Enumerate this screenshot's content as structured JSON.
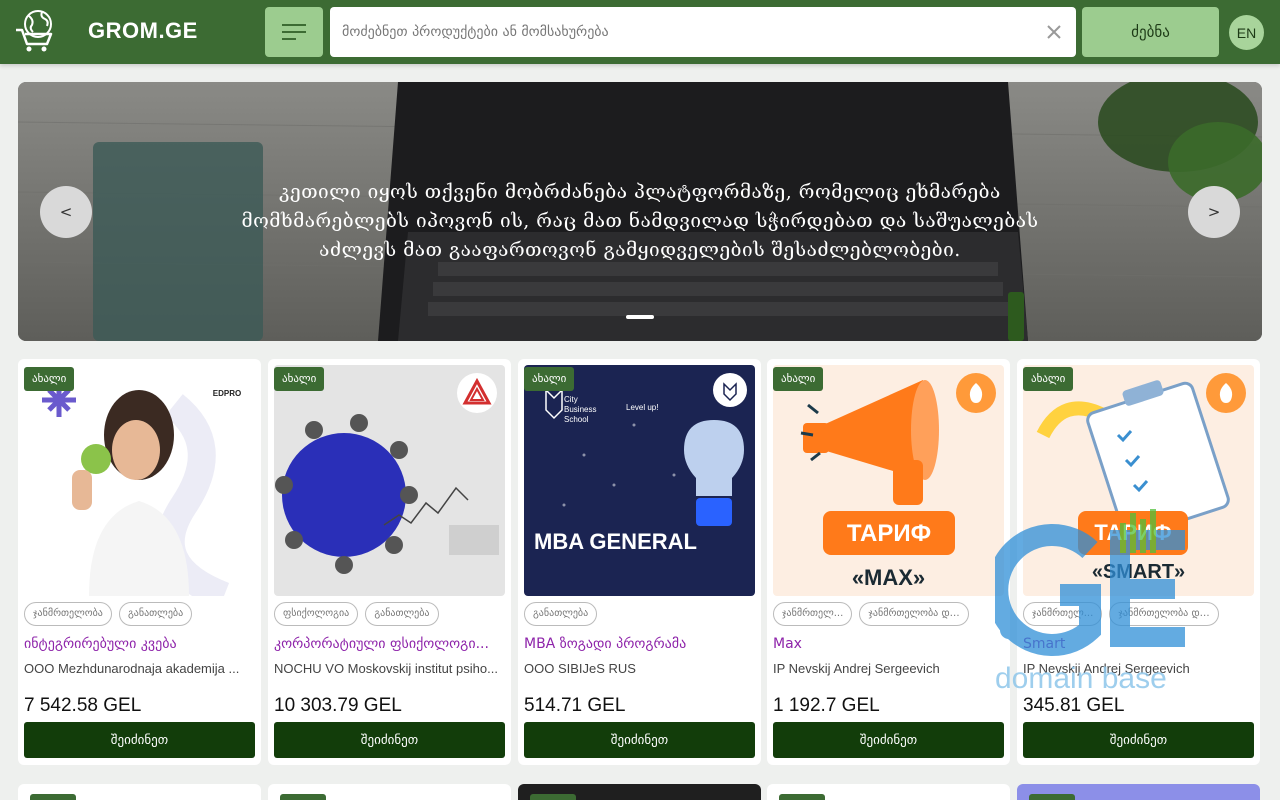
{
  "header": {
    "site_name": "GROM.GE",
    "search_placeholder": "მოძებნეთ პროდუქტები ან მომსახურება",
    "search_button": "ძებნა",
    "language": "EN"
  },
  "banner": {
    "text": "კეთილი იყოს თქვენი მობრძანება პლატფორმაზე, რომელიც ეხმარება მომხმარებლებს იპოვონ ის, რაც მათ ნამდვილად სჭირდებათ და საშუალებას აძლევს მათ გააფართოვონ გამყიდველების შესაძლებლობები.",
    "prev_label": "<",
    "next_label": ">"
  },
  "products": [
    {
      "badge": "ახალი",
      "image_text": "EDPRO",
      "tags": [
        "ჯანმრთელობა",
        "განათლება"
      ],
      "title": "ინტეგრირებული კვება",
      "seller": "OOO Mezhdunarodnaja akademija ...",
      "price": "7 542.58 GEL",
      "button": "შეიძინეთ"
    },
    {
      "badge": "ახალი",
      "image_text": "",
      "tags": [
        "ფსიქოლოგია",
        "განათლება"
      ],
      "title": "კორპორატიული ფსიქოლოგი...",
      "seller": "NOCHU VO Moskovskij institut psiho...",
      "price": "10 303.79 GEL",
      "button": "შეიძინეთ"
    },
    {
      "badge": "ახალი",
      "image_text": "MBA GENERAL",
      "image_subtext": "City Business School",
      "image_tagline": "Level up!",
      "tags": [
        "განათლება"
      ],
      "title": "MBA ზოგადი პროგრამა",
      "seller": "OOO SIBIJeS RUS",
      "price": "514.71 GEL",
      "button": "შეიძინეთ"
    },
    {
      "badge": "ახალი",
      "image_text": "ТАРИФ",
      "image_subtext": "«MAX»",
      "tags": [
        "ჯანმრთელ...",
        "ჯანმრთელობა და სპორ..."
      ],
      "title": "Max",
      "seller": "IP Nevskij Andrej Sergeevich",
      "price": "1 192.7 GEL",
      "button": "შეიძინეთ"
    },
    {
      "badge": "ახალი",
      "image_text": "ТАРИФ",
      "image_subtext": "«SMART»",
      "tags": [
        "ჯანმრთელ...",
        "ჯანმრთელობა და სპორ..."
      ],
      "title": "Smart",
      "seller": "IP Nevskij Andrej Sergeevich",
      "price": "345.81 GEL",
      "button": "შეიძინეთ"
    }
  ],
  "watermark": {
    "logo_text": ".GE",
    "caption": "domain base"
  },
  "colors": {
    "header_green": "#3c6b33",
    "light_green": "#9ccc8f",
    "button_dark": "#123d0a",
    "title_purple": "#8e24aa"
  }
}
